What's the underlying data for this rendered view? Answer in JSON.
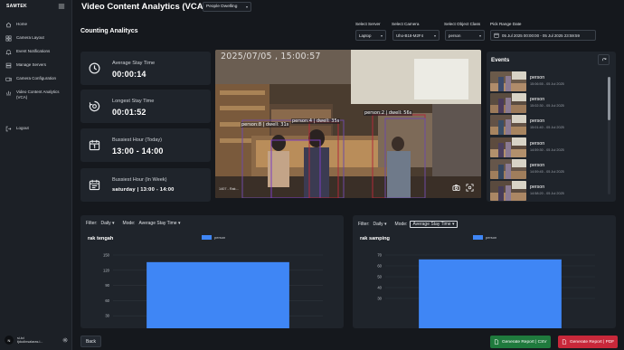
{
  "app": {
    "brand": "SAMTEK",
    "title": "Video Content Analytics (VCA)",
    "view_select": "People Dwelling"
  },
  "sidebar": {
    "items": [
      {
        "label": "Home",
        "icon": "home-icon"
      },
      {
        "label": "Camera Layout",
        "icon": "camera-layout-icon"
      },
      {
        "label": "Event Notifications",
        "icon": "bell-icon"
      },
      {
        "label": "Manage Servers",
        "icon": "server-icon"
      },
      {
        "label": "Camera Configuration",
        "icon": "camera-config-icon"
      },
      {
        "label": "Video Content Analytics (VCA)",
        "icon": "analytics-icon"
      }
    ],
    "logout": "Logout",
    "user": {
      "avatar": "N",
      "name_line1": "si-tci",
      "name_line2": "tjdudinsalaras.i..."
    }
  },
  "section_title": "Counting Analitycs",
  "filters": {
    "server": {
      "label": "Select Server",
      "value": "Laptop"
    },
    "camera": {
      "label": "Select Camera",
      "value": "Uho-B18-M2F4"
    },
    "object_class": {
      "label": "Select Object Class",
      "value": "person"
    },
    "date_range": {
      "label": "Pick Range Date",
      "value": "05 Jul 2025 00:00:00 - 05 Jul 2025 23:59:59"
    }
  },
  "stats": [
    {
      "label": "Average Stay Time",
      "value": "00:00:14",
      "icon": "clock-icon"
    },
    {
      "label": "Longest Stay Time",
      "value": "00:01:52",
      "icon": "timer-icon"
    },
    {
      "label": "Bussiest Hour (Today)",
      "value": "13:00 - 14:00",
      "icon": "calendar-day-icon"
    },
    {
      "label": "Bussiest Hour (In Week)",
      "value": "saturday | 13:00 - 14:00",
      "icon": "calendar-week-icon"
    }
  ],
  "video": {
    "timestamp": "2025/07/05 , 15:00:57",
    "camera_label": "1407 - Rak...",
    "detections": [
      "person:8 | dwell: 31s",
      "person:4 | dwell: 35s",
      "person:2 | dwell: 56s"
    ]
  },
  "events": {
    "title": "Events",
    "items": [
      {
        "label": "person",
        "time": "15:06:55 - 05 Jul 2025"
      },
      {
        "label": "person",
        "time": "15:02:30 - 05 Jul 2025"
      },
      {
        "label": "person",
        "time": "15:01:40 - 05 Jul 2025"
      },
      {
        "label": "person",
        "time": "14:59:30 - 05 Jul 2025"
      },
      {
        "label": "person",
        "time": "14:59:45 - 05 Jul 2025"
      },
      {
        "label": "person",
        "time": "14:58:20 - 05 Jul 2025"
      }
    ]
  },
  "panels": [
    {
      "filter_label": "Filter:",
      "filter_value": "Daily",
      "mode_label": "Mode:",
      "mode_value": "Average Stay Time",
      "name": "rak tengah"
    },
    {
      "filter_label": "Filter:",
      "filter_value": "Daily",
      "mode_label": "Mode:",
      "mode_value": "Average Stay Time",
      "name": "rak samping"
    }
  ],
  "chart_data": [
    {
      "type": "bar",
      "title": "rak tengah",
      "categories": [
        ""
      ],
      "series": [
        {
          "name": "person",
          "values": [
            136
          ]
        }
      ],
      "yticks": [
        150,
        120,
        90,
        60,
        30
      ],
      "ylim": [
        0,
        150
      ],
      "color": "#3f86f5",
      "grid": true,
      "legend": "top-center"
    },
    {
      "type": "bar",
      "title": "rak samping",
      "categories": [
        ""
      ],
      "series": [
        {
          "name": "person",
          "values": [
            66
          ]
        }
      ],
      "yticks": [
        70,
        60,
        50,
        40,
        30
      ],
      "ylim": [
        0,
        70
      ],
      "color": "#3f86f5",
      "grid": true,
      "legend": "top-center"
    }
  ],
  "footer": {
    "back": "Back",
    "csv": "Generate Report | CSV",
    "pdf": "Generate Report | PDF"
  },
  "colors": {
    "csv_button": "#1f7a3d",
    "pdf_button": "#c8283a",
    "chart_bar": "#3f86f5"
  }
}
